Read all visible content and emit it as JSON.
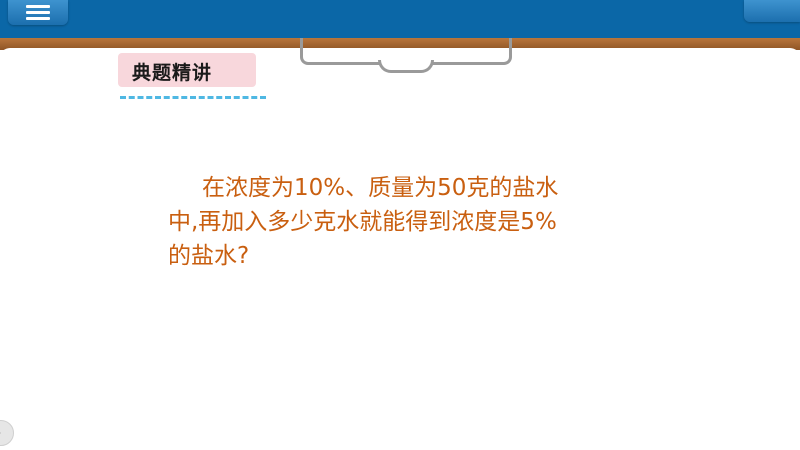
{
  "section": {
    "label": "典题精讲"
  },
  "question": {
    "line1": "在浓度为10%、质量为50克的盐水",
    "line2": "中,再加入多少克水就能得到浓度是5%",
    "line3": "的盐水?"
  },
  "colors": {
    "topbar": "#0b67a7",
    "question_text": "#c95f10",
    "section_tag_bg": "#f8d7dc",
    "dash_line": "#4fb8e3"
  },
  "icons": {
    "menu": "hamburger-menu-icon",
    "corner": "chevron-right-icon"
  }
}
